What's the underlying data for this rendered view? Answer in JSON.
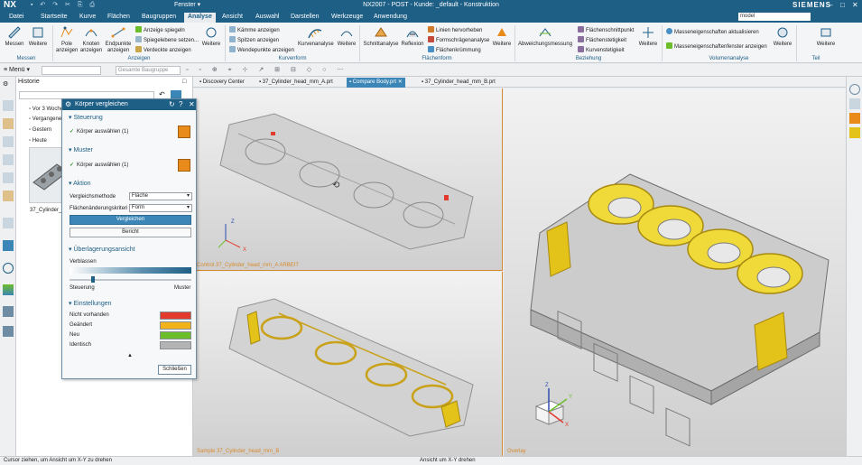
{
  "title_bar": {
    "app": "NX",
    "window_menu": "Fenster",
    "title": "NX2007 - POST - Kunde: _default - Konstruktion",
    "brand": "SIEMENS",
    "controls": [
      "–",
      "□",
      "✕"
    ]
  },
  "menu": {
    "tabs": [
      "Datei",
      "Startseite",
      "Kurve",
      "Flächen",
      "Baugruppen",
      "Analyse",
      "Ansicht",
      "Auswahl",
      "Darstellen",
      "Werkzeuge",
      "Anwendung"
    ],
    "active_tab": "Analyse",
    "search_value": "model"
  },
  "ribbon": {
    "groups": {
      "messen": "Messen",
      "anzeigen": "Anzeigen",
      "kurvenform": "Kurvenform",
      "flaechenform": "Flächenform",
      "beziehung": "Beziehung",
      "volumenanalyse": "Volumenanalyse",
      "teil": "Teil"
    },
    "messen": {
      "messen": "Messen",
      "weitere": "Weitere"
    },
    "anzeigen": {
      "pole": "Pole anzeigen",
      "knoten": "Knoten anzeigen",
      "endpunkte": "Endpunkte anzeigen",
      "spiegeln": "Anzeige spiegeln",
      "spiegelebene": "Spiegelebene setzen...",
      "verdeckte": "Verdeckte anzeigen",
      "weitere": "Weitere"
    },
    "kurvenform": {
      "kaemme": "Kämme anzeigen",
      "spitzen": "Spitzen anzeigen",
      "wendepunkte": "Wendepunkte anzeigen",
      "kurvenanalyse": "Kurvenanalyse",
      "weitere": "Weitere"
    },
    "flaechenform": {
      "schnittanalyse": "Schnittanalyse",
      "reflexion": "Reflexion",
      "linien": "Linien hervorheben",
      "formschraege": "Formschrägenanalyse",
      "flaechenkruemmung": "Flächenkrümmung",
      "weitere": "Weitere"
    },
    "beziehung": {
      "abweichung": "Abweichungsmessung",
      "schnittpunkt": "Flächenschnittpunkt",
      "stetigkeit": "Flächenstetigkeit",
      "kurvenstetigkeit": "Kurvenstetigkeit",
      "weitere": "Weitere"
    },
    "volumenanalyse": {
      "aktualisieren": "Masseneigenschaften aktualisieren",
      "fenster": "Masseneigenschaftenfenster anzeigen",
      "weitere": "Weitere"
    },
    "teil": {
      "weitere": "Weitere"
    }
  },
  "toolbar2": {
    "menu_label": "Menü",
    "dropdown1": "",
    "dropdown2": "Gesamte Baugruppe"
  },
  "nav_panel": {
    "header": "Historie",
    "items": [
      "Vor 3 Wochen",
      "Vergangene W",
      "Gestern",
      "Heute"
    ],
    "thumbnail_caption": "37_Cylinder_hc fro"
  },
  "dialog": {
    "title": "Körper vergleichen",
    "steuerung": {
      "section": "Steuerung",
      "select": "Körper auswählen (1)"
    },
    "muster": {
      "section": "Muster",
      "select": "Körper auswählen (1)"
    },
    "aktion": {
      "section": "Aktion",
      "method_label": "Vergleichsmethode",
      "method_value": "Fläche",
      "criteria_label": "Flächenänderungskriteri",
      "criteria_value": "Form",
      "compare_button": "Vergleichen",
      "report_button": "Bericht"
    },
    "overlay": {
      "section": "Überlagerungsansicht",
      "fade_label": "Verblassen",
      "left_label": "Steuerung",
      "right_label": "Muster",
      "slider_value": 0.18
    },
    "settings": {
      "section": "Einstellungen",
      "rows": [
        {
          "label": "Nicht vorhanden",
          "color": "#e23b2e"
        },
        {
          "label": "Geändert",
          "color": "#f2b21a"
        },
        {
          "label": "Neu",
          "color": "#6cbd2a"
        },
        {
          "label": "Identisch",
          "color": "#b4b4b4"
        }
      ]
    },
    "close_button": "Schließen"
  },
  "doc_tabs": [
    {
      "label": "Discovery Center",
      "active": false
    },
    {
      "label": "37_Cylinder_head_mm_A.prt",
      "active": false
    },
    {
      "label": "Compare Body.prt",
      "active": true
    },
    {
      "label": "37_Cylinder_head_mm_B.prt",
      "active": false
    }
  ],
  "viewports": {
    "top_left": "Control 37_Cylinder_head_mm_A ARBEIT",
    "bottom_left": "Sample 37_Cylinder_head_mm_B",
    "right": "Overlay"
  },
  "status": {
    "left": "Cursor ziehen, um Ansicht um X-Y zu drehen",
    "center": "Ansicht um X-Y drehen"
  },
  "colors": {
    "accent": "#1e5f86",
    "highlight": "#e3c21a",
    "active_tab": "#3b86b6"
  }
}
